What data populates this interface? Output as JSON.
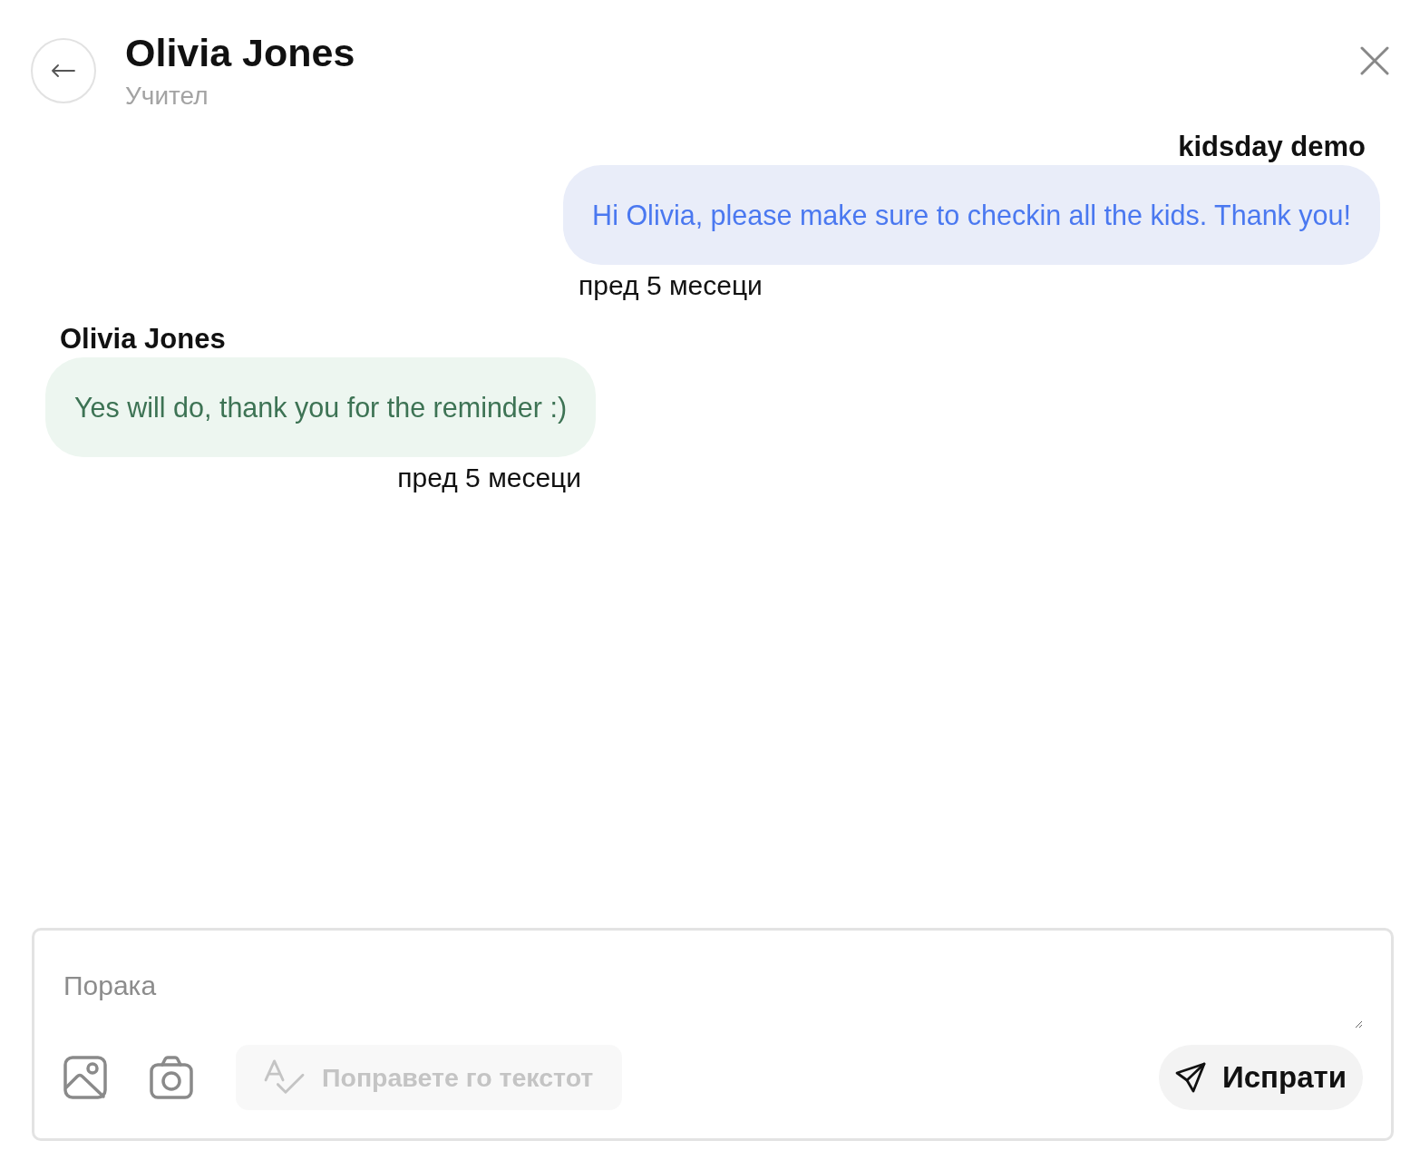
{
  "header": {
    "title": "Olivia Jones",
    "subtitle": "Учител"
  },
  "messages": [
    {
      "kind": "outgoing",
      "sender": "kidsday demo",
      "text": "Hi Olivia, please make sure to checkin all the kids. Thank you!",
      "time": "пред 5 месеци"
    },
    {
      "kind": "incoming",
      "sender": "Olivia Jones",
      "text": "Yes will do, thank you for the reminder :)",
      "time": "пред 5 месеци"
    }
  ],
  "composer": {
    "placeholder": "Порака",
    "fix_text_button": {
      "label": "Поправете го текстот",
      "disabled": true
    },
    "send_button": {
      "label": "Испрати"
    }
  }
}
